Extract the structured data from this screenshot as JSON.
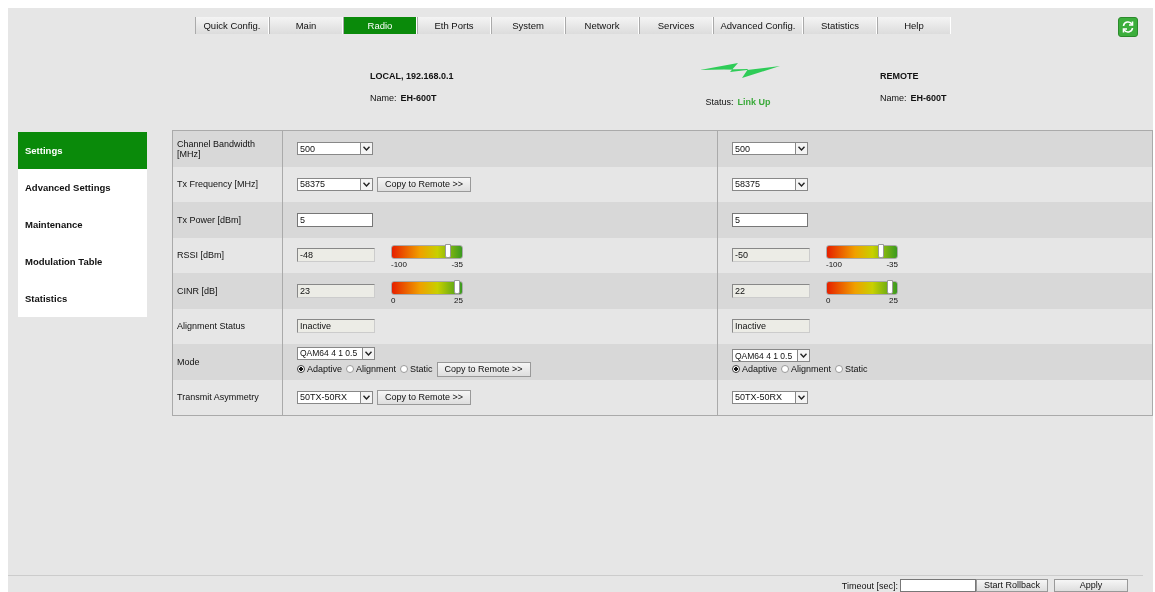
{
  "tabs": [
    {
      "label": "Quick Config.",
      "selected": false
    },
    {
      "label": "Main",
      "selected": false
    },
    {
      "label": "Radio",
      "selected": true
    },
    {
      "label": "Eth Ports",
      "selected": false
    },
    {
      "label": "System",
      "selected": false
    },
    {
      "label": "Network",
      "selected": false
    },
    {
      "label": "Services",
      "selected": false
    },
    {
      "label": "Advanced Config.",
      "selected": false
    },
    {
      "label": "Statistics",
      "selected": false
    },
    {
      "label": "Help",
      "selected": false
    }
  ],
  "header": {
    "local": {
      "title": "LOCAL, 192.168.0.1",
      "name_label": "Name:",
      "name": "EH-600T"
    },
    "status_label": "Status:",
    "status": "Link Up",
    "remote": {
      "title": "REMOTE",
      "name_label": "Name:",
      "name": "EH-600T"
    }
  },
  "sidebar": [
    {
      "label": "Settings",
      "selected": true
    },
    {
      "label": "Advanced Settings",
      "selected": false
    },
    {
      "label": "Maintenance",
      "selected": false
    },
    {
      "label": "Modulation Table",
      "selected": false
    },
    {
      "label": "Statistics",
      "selected": false
    }
  ],
  "rows": [
    {
      "label": "Channel Bandwidth [MHz]",
      "local": {
        "kind": "select",
        "value": "500"
      },
      "remote": {
        "kind": "select",
        "value": "500"
      }
    },
    {
      "label": "Tx Frequency [MHz]",
      "local": {
        "kind": "select",
        "value": "58375",
        "copy_button": "Copy to Remote >>"
      },
      "remote": {
        "kind": "select",
        "value": "58375"
      }
    },
    {
      "label": "Tx Power [dBm]",
      "local": {
        "kind": "input",
        "value": "5"
      },
      "remote": {
        "kind": "input",
        "value": "5"
      }
    },
    {
      "label": "RSSI [dBm]",
      "local": {
        "kind": "meter",
        "value": "-48",
        "level": 0.78,
        "min_label": "-100",
        "max_label": "-35"
      },
      "remote": {
        "kind": "meter",
        "value": "-50",
        "level": 0.75,
        "min_label": "-100",
        "max_label": "-35"
      }
    },
    {
      "label": "CINR [dB]",
      "local": {
        "kind": "meter",
        "value": "23",
        "level": 0.92,
        "min_label": "0",
        "max_label": "25"
      },
      "remote": {
        "kind": "meter",
        "value": "22",
        "level": 0.88,
        "min_label": "0",
        "max_label": "25"
      }
    },
    {
      "label": "Alignment Status",
      "local": {
        "kind": "readonly",
        "value": "Inactive"
      },
      "remote": {
        "kind": "readonly",
        "value": "Inactive"
      }
    },
    {
      "label": "Mode",
      "local": {
        "kind": "mode",
        "value": "QAM64 4 1 0.5",
        "options": [
          {
            "label": "Adaptive",
            "selected": true
          },
          {
            "label": "Alignment",
            "selected": false
          },
          {
            "label": "Static",
            "selected": false
          }
        ],
        "copy_button": "Copy to Remote >>"
      },
      "remote": {
        "kind": "mode",
        "value": "QAM64 4 1 0.5",
        "options": [
          {
            "label": "Adaptive",
            "selected": true
          },
          {
            "label": "Alignment",
            "selected": false
          },
          {
            "label": "Static",
            "selected": false
          }
        ]
      }
    },
    {
      "label": "Transmit Asymmetry",
      "local": {
        "kind": "select",
        "value": "50TX-50RX",
        "copy_button": "Copy to Remote >>"
      },
      "remote": {
        "kind": "select",
        "value": "50TX-50RX"
      }
    }
  ],
  "footer": {
    "timeout_label": "Timeout [sec]:",
    "rollback_button": "Start Rollback",
    "apply_button": "Apply"
  }
}
